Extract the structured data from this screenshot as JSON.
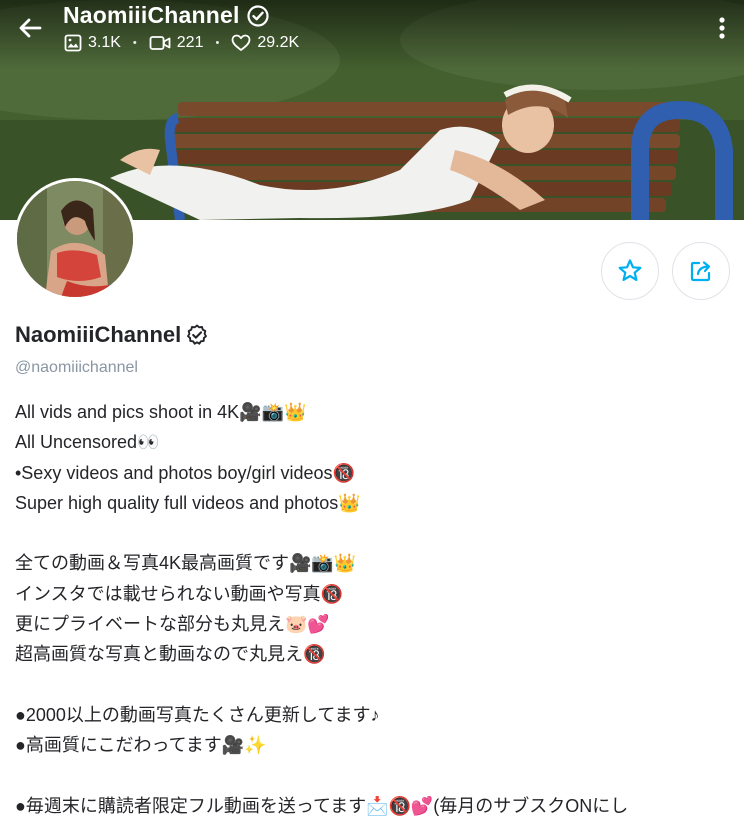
{
  "header": {
    "title": "NaomiiiChannel",
    "stats": {
      "photos": "3.1K",
      "videos": "221",
      "likes": "29.2K"
    }
  },
  "profile": {
    "name": "NaomiiiChannel",
    "handle": "@naomiiichannel"
  },
  "bio": {
    "lines": [
      "All vids and pics shoot in 4K🎥📸👑",
      "All Uncensored👀",
      "•Sexy videos and photos boy/girl videos🔞",
      "Super high quality full videos and photos👑",
      "",
      "全ての動画＆写真4K最高画質です🎥📸👑",
      "インスタでは載せられない動画や写真🔞",
      "更にプライベートな部分も丸見え🐷💕",
      "超高画質な写真と動画なので丸見え🔞",
      "",
      "●2000以上の動画写真たくさん更新してます♪",
      "●高画質にこだわってます🎥✨",
      "",
      "●毎週末に購読者限定フル動画を送ってます📩🔞💕(毎月のサブスクONにし"
    ]
  },
  "icons": {
    "back": "back-arrow-icon",
    "verified": "verified-badge-icon",
    "photos": "image-icon",
    "videos": "video-camera-icon",
    "likes": "heart-icon",
    "more": "more-vertical-icon",
    "favorite": "star-icon",
    "share": "share-icon"
  },
  "colors": {
    "accent": "#00aff0",
    "text": "#242529",
    "muted": "#8a96a3",
    "border": "#dfe3e8"
  }
}
